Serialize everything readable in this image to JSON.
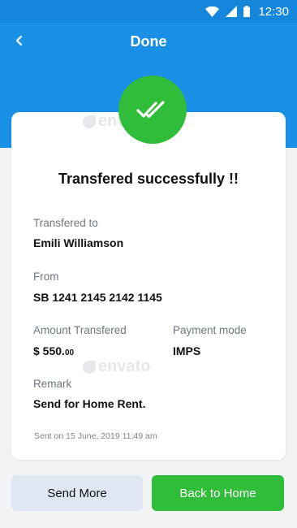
{
  "status_bar": {
    "time": "12:30"
  },
  "header": {
    "title": "Done"
  },
  "card": {
    "heading": "Transfered successfully !!",
    "transferred_to": {
      "label": "Transfered to",
      "value": "Emili Williamson"
    },
    "from": {
      "label": "From",
      "value": "SB 1241 2145 2142 1145"
    },
    "amount": {
      "label": "Amount Transfered",
      "whole": "$ 550.",
      "cents": "00"
    },
    "payment_mode": {
      "label": "Payment mode",
      "value": "IMPS"
    },
    "remark": {
      "label": "Remark",
      "value": "Send for Home Rent."
    },
    "sent_on": "Sent on 15 June, 2019  11:49 am"
  },
  "watermark": "envato",
  "actions": {
    "send_more": "Send More",
    "back_home": "Back to Home"
  },
  "colors": {
    "header_blue": "#1a8fe6",
    "success_green": "#2fbd3a",
    "secondary_button": "#dfe8f2"
  },
  "icons": [
    "wifi-icon",
    "signal-icon",
    "battery-icon",
    "back-arrow-icon",
    "double-check-icon"
  ]
}
